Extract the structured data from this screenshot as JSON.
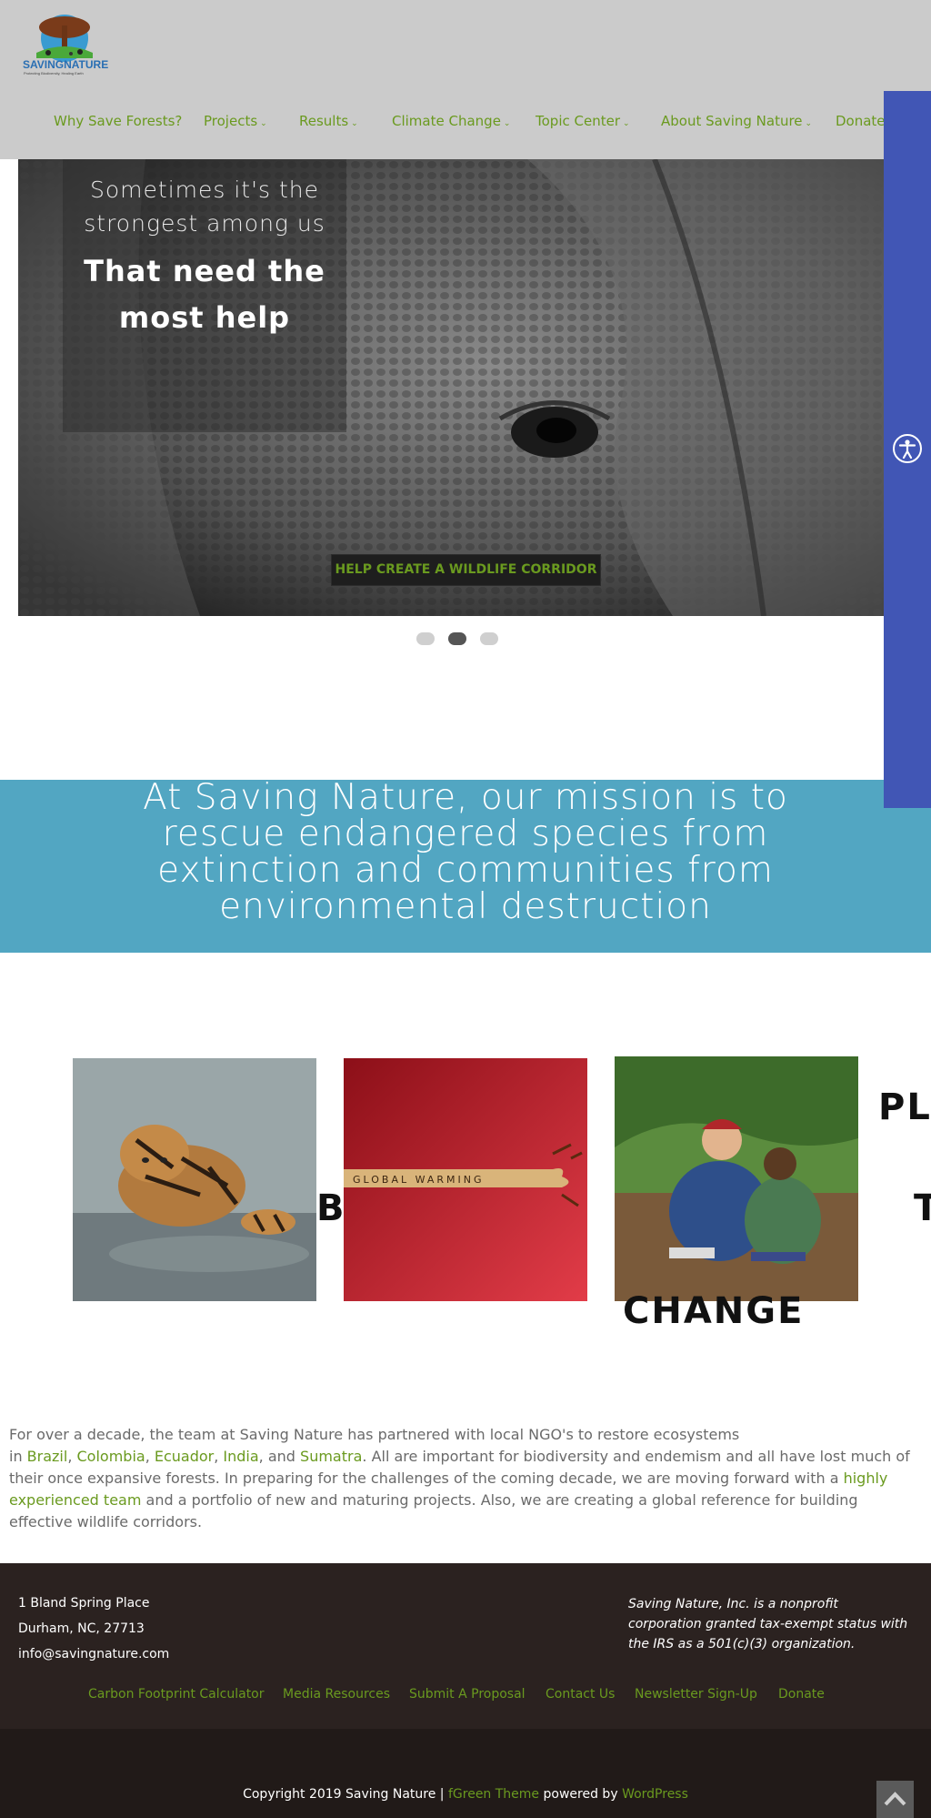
{
  "header": {
    "logo_name": "SAVINGNATURE",
    "logo_tagline": "Protecting Biodiversity, Healing Earth",
    "nav": [
      {
        "label": "Why Save Forests?",
        "has_dropdown": false
      },
      {
        "label": "Projects",
        "has_dropdown": true
      },
      {
        "label": "Results",
        "has_dropdown": true
      },
      {
        "label": "Climate Change",
        "has_dropdown": true
      },
      {
        "label": "Topic Center",
        "has_dropdown": true
      },
      {
        "label": "About Saving Nature",
        "has_dropdown": true
      },
      {
        "label": "Donate",
        "has_dropdown": false
      }
    ],
    "chevron": "⌄"
  },
  "hero": {
    "line1": "Sometimes it's the strongest among us",
    "line2": "That need the most help",
    "cta": "HELP CREATE A WILDLIFE CORRIDOR",
    "slides": 3,
    "active_slide": 2
  },
  "accessibility": {
    "icon": "accessibility-icon"
  },
  "mission": {
    "text": "At Saving Nature, our mission is to rescue endangered species from extinction and communities from environmental destruction"
  },
  "cards": [
    {
      "image": "tiger-cub",
      "label": "B"
    },
    {
      "image": "global-warming",
      "image_text": "GLOBAL WARMING",
      "label": "T"
    },
    {
      "image": "tree-planting",
      "label": "PLA",
      "label2": "CHANGE"
    }
  ],
  "intro": {
    "p1": "For over a decade, the team at Saving Nature has partnered with local NGO's to restore ecosystems",
    "p2_pre": "in ",
    "links": [
      "Brazil",
      "Colombia",
      "Ecuador",
      "India",
      "Sumatra"
    ],
    "and": "and",
    "p3": ". All are important for biodiversity and endemism and all have lost much of their once expansive forests.  In preparing for the challenges of the coming decade, we are moving forward with a ",
    "team_link": "highly experienced team",
    "p4": " and a portfolio of new and maturing projects. Also, we are creating a global reference for building effective wildlife corridors."
  },
  "footer": {
    "address": [
      "1 Bland Spring Place",
      "Durham, NC, 27713",
      "info@savingnature.com"
    ],
    "nonprofit": "Saving Nature, Inc. is a nonprofit corporation granted tax-exempt status with the IRS as a 501(c)(3) organization.",
    "links": [
      "Carbon Footprint Calculator",
      "Media Resources",
      "Submit A Proposal",
      "Contact Us",
      "Newsletter Sign-Up",
      "Donate"
    ],
    "copyright_pre": "Copyright 2019 Saving Nature | ",
    "theme_link": "fGreen Theme",
    "powered": " powered by ",
    "wp_link": "WordPress"
  },
  "colors": {
    "accent_green": "#6a9a1f",
    "header_bg": "#cbcbcb",
    "mission_bg": "#52a6c2",
    "accessibility_bg": "#4156b5",
    "footer_bg": "#2b2220"
  }
}
